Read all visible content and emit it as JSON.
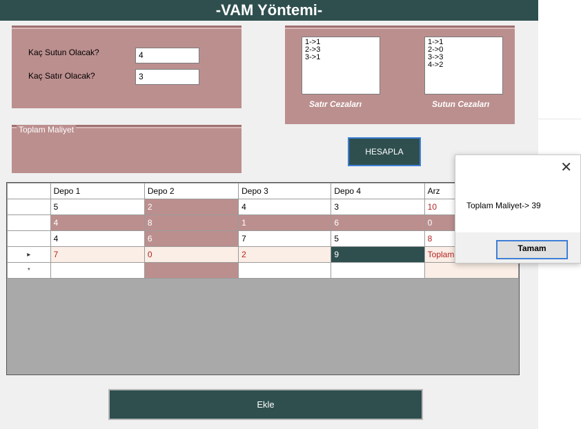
{
  "title": "-VAM Yöntemi-",
  "inputs": {
    "cols_label": "Kaç Sutun Olacak?",
    "cols_value": "4",
    "rows_label": "Kaç Satır Olacak?",
    "rows_value": "3"
  },
  "penalties": {
    "row_label": "Satır Cezaları",
    "col_label": "Sutun Cezaları",
    "row_items": [
      "1->1",
      "2->3",
      "3->1"
    ],
    "col_items": [
      "1->1",
      "2->0",
      "3->3",
      "4->2"
    ]
  },
  "total_group_label": "Toplam Maliyet",
  "hesapla_label": "HESAPLA",
  "ekle_label": "Ekle",
  "grid": {
    "headers": [
      "Depo 1",
      "Depo 2",
      "Depo 3",
      "Depo 4",
      "Arz"
    ],
    "rows": [
      [
        "5",
        "2",
        "4",
        "3",
        "10"
      ],
      [
        "4",
        "8",
        "1",
        "6",
        "0"
      ],
      [
        "4",
        "6",
        "7",
        "5",
        "8"
      ],
      [
        "7",
        "0",
        "2",
        "9",
        "Toplam Maliyet"
      ],
      [
        "",
        "",
        "",
        "",
        ""
      ]
    ],
    "row_markers": [
      "",
      "",
      "",
      "▸",
      "*"
    ]
  },
  "dialog": {
    "message": "Toplam Maliyet-> 39",
    "ok_label": "Tamam",
    "close_glyph": "✕"
  },
  "colors": {
    "dark_teal": "#2f4f4f",
    "rosy_brown": "#bc8f8f",
    "cream": "#faeee6",
    "red_text": "#b22222"
  }
}
